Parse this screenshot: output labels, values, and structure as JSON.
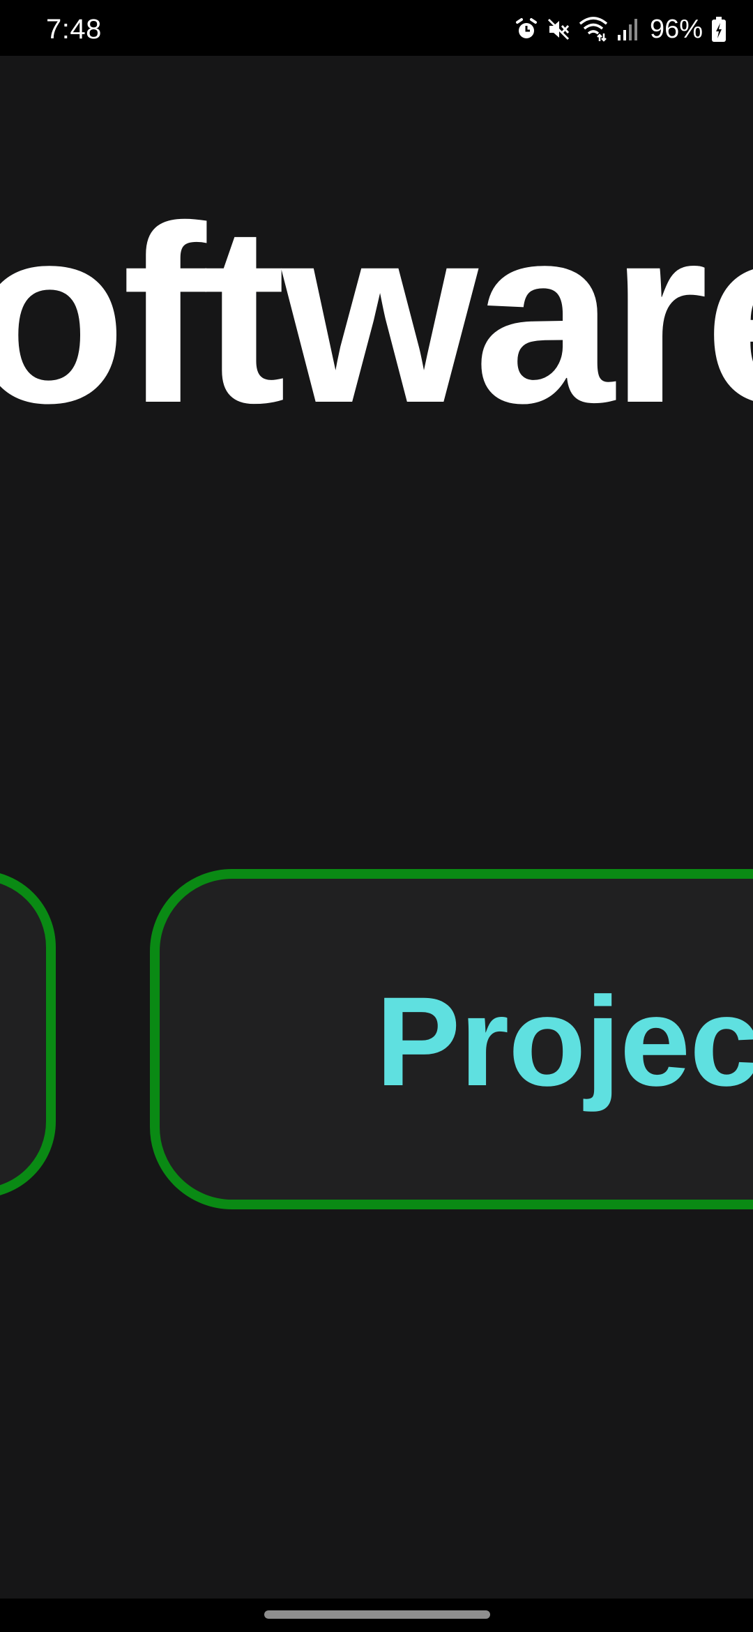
{
  "status_bar": {
    "time": "7:48",
    "battery": "96%",
    "icons": [
      "alarm-icon",
      "mute-icon",
      "wifi-icon",
      "signal-icon",
      "battery-charging-icon"
    ]
  },
  "main": {
    "headline": "oftware",
    "projects_button_label": "Project"
  },
  "colors": {
    "background": "#161617",
    "pill_border": "#0a8a14",
    "pill_fill": "#202021",
    "projects_text": "#5fe0e0",
    "headline_text": "#ffffff"
  }
}
